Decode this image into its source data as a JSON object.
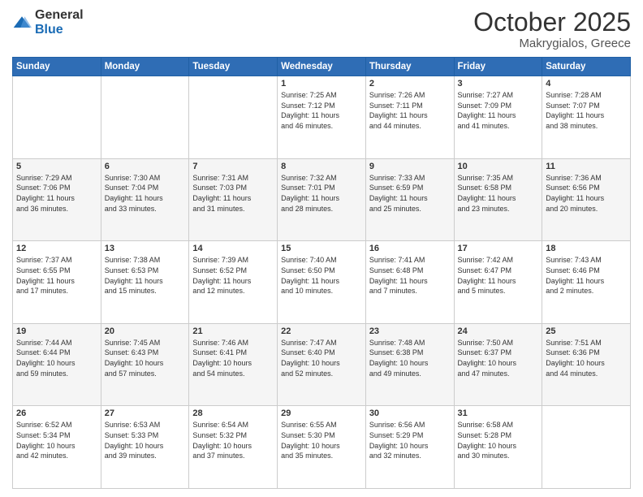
{
  "header": {
    "logo": {
      "general": "General",
      "blue": "Blue"
    },
    "title": "October 2025",
    "location": "Makrygialos, Greece"
  },
  "days_of_week": [
    "Sunday",
    "Monday",
    "Tuesday",
    "Wednesday",
    "Thursday",
    "Friday",
    "Saturday"
  ],
  "weeks": [
    [
      {
        "day": "",
        "info": ""
      },
      {
        "day": "",
        "info": ""
      },
      {
        "day": "",
        "info": ""
      },
      {
        "day": "1",
        "info": "Sunrise: 7:25 AM\nSunset: 7:12 PM\nDaylight: 11 hours\nand 46 minutes."
      },
      {
        "day": "2",
        "info": "Sunrise: 7:26 AM\nSunset: 7:11 PM\nDaylight: 11 hours\nand 44 minutes."
      },
      {
        "day": "3",
        "info": "Sunrise: 7:27 AM\nSunset: 7:09 PM\nDaylight: 11 hours\nand 41 minutes."
      },
      {
        "day": "4",
        "info": "Sunrise: 7:28 AM\nSunset: 7:07 PM\nDaylight: 11 hours\nand 38 minutes."
      }
    ],
    [
      {
        "day": "5",
        "info": "Sunrise: 7:29 AM\nSunset: 7:06 PM\nDaylight: 11 hours\nand 36 minutes."
      },
      {
        "day": "6",
        "info": "Sunrise: 7:30 AM\nSunset: 7:04 PM\nDaylight: 11 hours\nand 33 minutes."
      },
      {
        "day": "7",
        "info": "Sunrise: 7:31 AM\nSunset: 7:03 PM\nDaylight: 11 hours\nand 31 minutes."
      },
      {
        "day": "8",
        "info": "Sunrise: 7:32 AM\nSunset: 7:01 PM\nDaylight: 11 hours\nand 28 minutes."
      },
      {
        "day": "9",
        "info": "Sunrise: 7:33 AM\nSunset: 6:59 PM\nDaylight: 11 hours\nand 25 minutes."
      },
      {
        "day": "10",
        "info": "Sunrise: 7:35 AM\nSunset: 6:58 PM\nDaylight: 11 hours\nand 23 minutes."
      },
      {
        "day": "11",
        "info": "Sunrise: 7:36 AM\nSunset: 6:56 PM\nDaylight: 11 hours\nand 20 minutes."
      }
    ],
    [
      {
        "day": "12",
        "info": "Sunrise: 7:37 AM\nSunset: 6:55 PM\nDaylight: 11 hours\nand 17 minutes."
      },
      {
        "day": "13",
        "info": "Sunrise: 7:38 AM\nSunset: 6:53 PM\nDaylight: 11 hours\nand 15 minutes."
      },
      {
        "day": "14",
        "info": "Sunrise: 7:39 AM\nSunset: 6:52 PM\nDaylight: 11 hours\nand 12 minutes."
      },
      {
        "day": "15",
        "info": "Sunrise: 7:40 AM\nSunset: 6:50 PM\nDaylight: 11 hours\nand 10 minutes."
      },
      {
        "day": "16",
        "info": "Sunrise: 7:41 AM\nSunset: 6:48 PM\nDaylight: 11 hours\nand 7 minutes."
      },
      {
        "day": "17",
        "info": "Sunrise: 7:42 AM\nSunset: 6:47 PM\nDaylight: 11 hours\nand 5 minutes."
      },
      {
        "day": "18",
        "info": "Sunrise: 7:43 AM\nSunset: 6:46 PM\nDaylight: 11 hours\nand 2 minutes."
      }
    ],
    [
      {
        "day": "19",
        "info": "Sunrise: 7:44 AM\nSunset: 6:44 PM\nDaylight: 10 hours\nand 59 minutes."
      },
      {
        "day": "20",
        "info": "Sunrise: 7:45 AM\nSunset: 6:43 PM\nDaylight: 10 hours\nand 57 minutes."
      },
      {
        "day": "21",
        "info": "Sunrise: 7:46 AM\nSunset: 6:41 PM\nDaylight: 10 hours\nand 54 minutes."
      },
      {
        "day": "22",
        "info": "Sunrise: 7:47 AM\nSunset: 6:40 PM\nDaylight: 10 hours\nand 52 minutes."
      },
      {
        "day": "23",
        "info": "Sunrise: 7:48 AM\nSunset: 6:38 PM\nDaylight: 10 hours\nand 49 minutes."
      },
      {
        "day": "24",
        "info": "Sunrise: 7:50 AM\nSunset: 6:37 PM\nDaylight: 10 hours\nand 47 minutes."
      },
      {
        "day": "25",
        "info": "Sunrise: 7:51 AM\nSunset: 6:36 PM\nDaylight: 10 hours\nand 44 minutes."
      }
    ],
    [
      {
        "day": "26",
        "info": "Sunrise: 6:52 AM\nSunset: 5:34 PM\nDaylight: 10 hours\nand 42 minutes."
      },
      {
        "day": "27",
        "info": "Sunrise: 6:53 AM\nSunset: 5:33 PM\nDaylight: 10 hours\nand 39 minutes."
      },
      {
        "day": "28",
        "info": "Sunrise: 6:54 AM\nSunset: 5:32 PM\nDaylight: 10 hours\nand 37 minutes."
      },
      {
        "day": "29",
        "info": "Sunrise: 6:55 AM\nSunset: 5:30 PM\nDaylight: 10 hours\nand 35 minutes."
      },
      {
        "day": "30",
        "info": "Sunrise: 6:56 AM\nSunset: 5:29 PM\nDaylight: 10 hours\nand 32 minutes."
      },
      {
        "day": "31",
        "info": "Sunrise: 6:58 AM\nSunset: 5:28 PM\nDaylight: 10 hours\nand 30 minutes."
      },
      {
        "day": "",
        "info": ""
      }
    ]
  ]
}
